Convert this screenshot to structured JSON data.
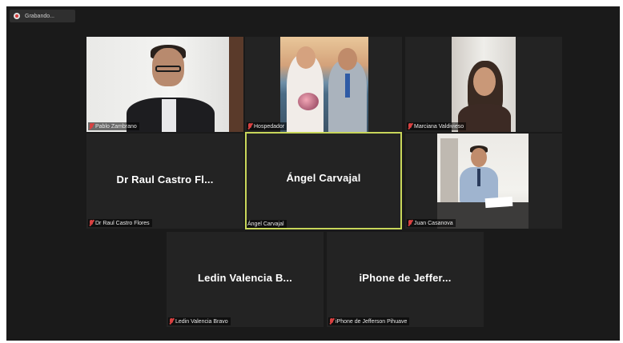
{
  "recording": {
    "label": "Grabando..."
  },
  "participants": [
    {
      "key": "pablo",
      "name": "Pablo Zambrano",
      "muted": true,
      "video": true
    },
    {
      "key": "host",
      "name": "Hospedador",
      "muted": true,
      "video": true
    },
    {
      "key": "marciana",
      "name": "Marciana Valdivieso",
      "muted": true,
      "video": true
    },
    {
      "key": "raul",
      "name": "Dr Raul Castro Flores",
      "display_name": "Dr Raul Castro Fl...",
      "muted": true,
      "video": false
    },
    {
      "key": "angel",
      "name": "Ángel Carvajal",
      "display_name": "Ángel Carvajal",
      "muted": false,
      "video": false,
      "speaking": true
    },
    {
      "key": "juan",
      "name": "Juan Casanova",
      "muted": true,
      "video": true
    },
    {
      "key": "ledin",
      "name": "Ledin Valencia Bravo",
      "display_name": "Ledin Valencia B...",
      "muted": true,
      "video": false
    },
    {
      "key": "iphone",
      "name": "iPhone de Jefferson Pihuave",
      "display_name": "iPhone de Jeffer...",
      "muted": true,
      "video": false
    }
  ],
  "colors": {
    "active_speaker_border": "#c8d65a",
    "muted_mic": "#d94141",
    "tile_bg": "#232323",
    "window_bg": "#1a1a1a"
  },
  "icons": {
    "recording": "record-dot-icon",
    "muted": "mic-muted-icon"
  }
}
